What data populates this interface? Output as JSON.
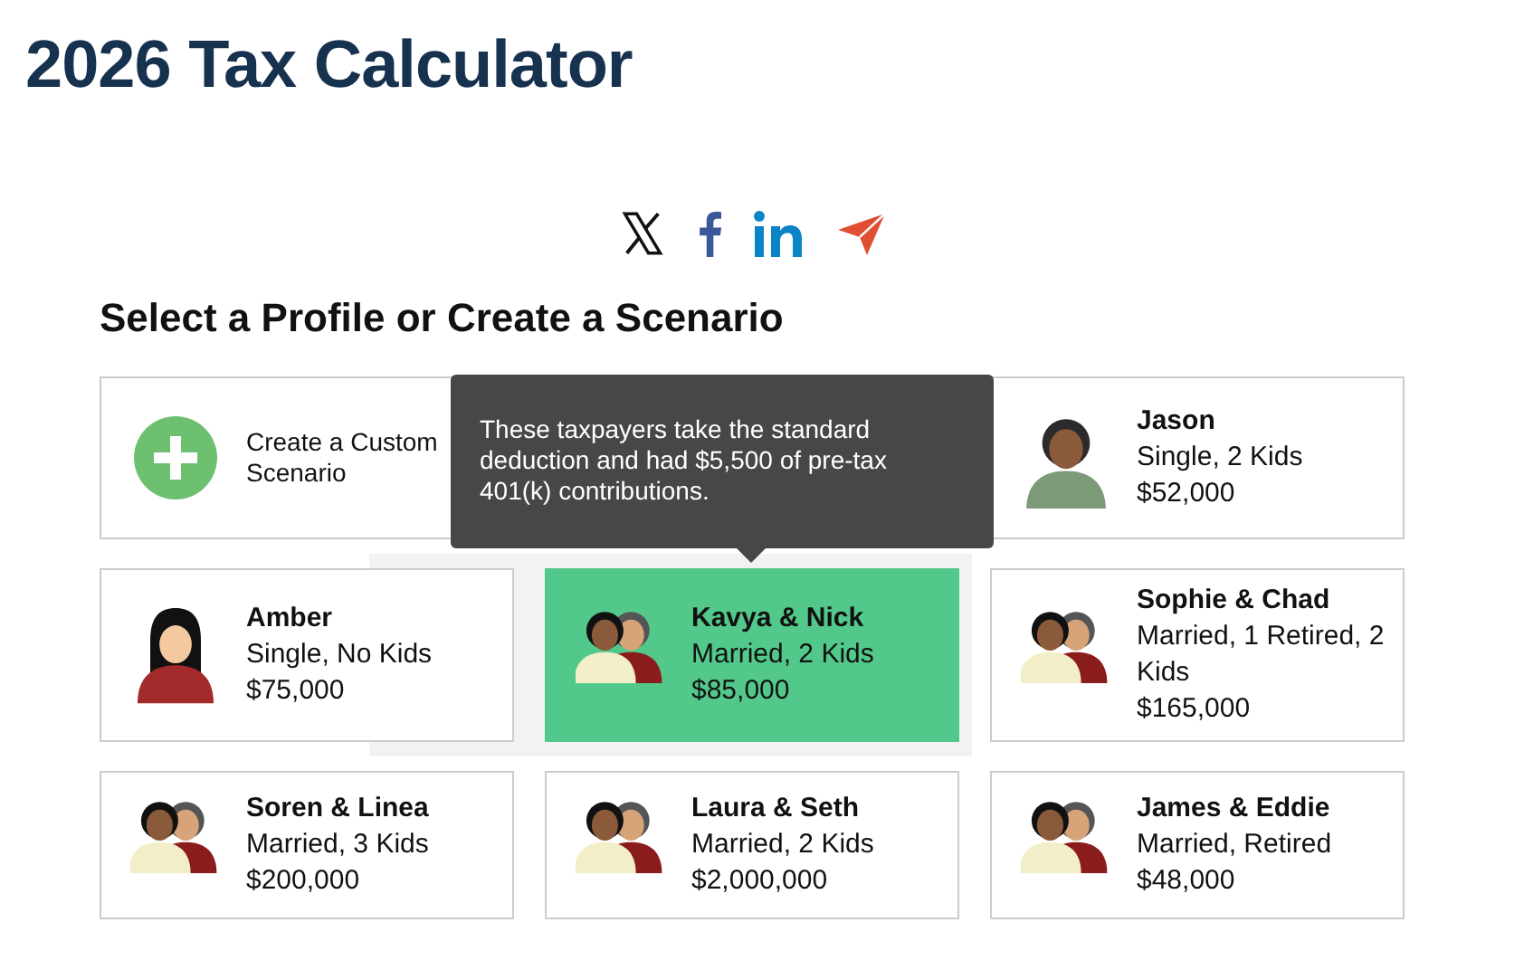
{
  "title": "2026 Tax Calculator",
  "share": [
    {
      "kind": "x"
    },
    {
      "kind": "facebook"
    },
    {
      "kind": "linkedin"
    },
    {
      "kind": "send"
    }
  ],
  "heading": "Select a Profile or Create a Scenario",
  "profiles": [
    {
      "kind": "create",
      "name": "Create a Custom Scenario",
      "selected": false
    },
    {
      "kind": "covered"
    },
    {
      "kind": "single",
      "name": "Jason",
      "details": "Single, 2 Kids",
      "income": "$52,000",
      "selected": false
    },
    {
      "kind": "single-woman",
      "name": "Amber",
      "details": "Single, No Kids",
      "income": "$75,000",
      "selected": false
    },
    {
      "kind": "couple",
      "name": "Kavya & Nick",
      "details": "Married, 2 Kids",
      "income": "$85,000",
      "selected": true
    },
    {
      "kind": "couple",
      "name": "Sophie & Chad",
      "details": "Married, 1 Retired, 2 Kids",
      "income": "$165,000",
      "selected": false
    },
    {
      "kind": "couple",
      "name": "Soren & Linea",
      "details": "Married, 3 Kids",
      "income": "$200,000",
      "selected": false
    },
    {
      "kind": "couple",
      "name": "Laura & Seth",
      "details": "Married, 2 Kids",
      "income": "$2,000,000",
      "selected": false
    },
    {
      "kind": "couple",
      "name": "James & Eddie",
      "details": "Married, Retired",
      "income": "$48,000",
      "selected": false
    }
  ],
  "tooltip": {
    "text": "These taxpayers take the standard deduction and had $5,500 of pre-tax 401(k) contributions."
  }
}
